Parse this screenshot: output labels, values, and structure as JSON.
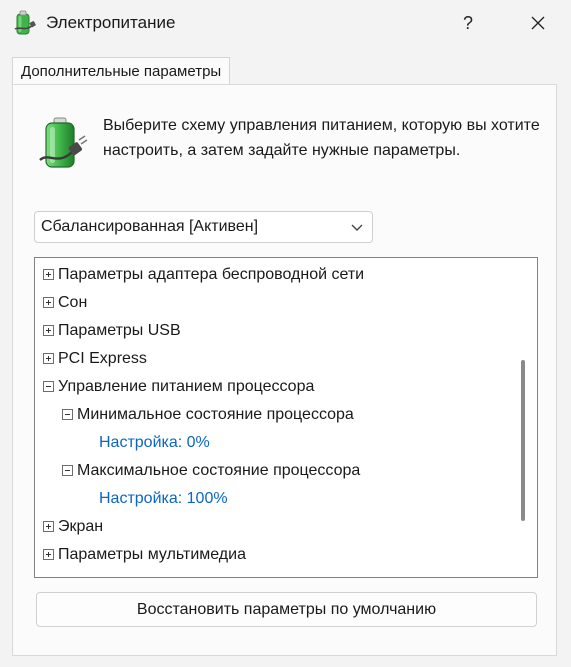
{
  "window": {
    "title": "Электропитание",
    "help_label": "?"
  },
  "tabs": [
    {
      "label": "Дополнительные параметры",
      "selected": true
    }
  ],
  "instructions": "Выберите схему управления питанием, которую вы хотите настроить, а затем задайте нужные параметры.",
  "scheme_select": {
    "value": "Сбалансированная [Активен]"
  },
  "tree": {
    "items": [
      {
        "label": "Параметры адаптера беспроводной сети",
        "expander": "plus",
        "level": 0
      },
      {
        "label": "Сон",
        "expander": "plus",
        "level": 0
      },
      {
        "label": "Параметры USB",
        "expander": "plus",
        "level": 0
      },
      {
        "label": "PCI Express",
        "expander": "plus",
        "level": 0
      },
      {
        "label": "Управление питанием процессора",
        "expander": "minus",
        "level": 0
      },
      {
        "label": "Минимальное состояние процессора",
        "expander": "minus",
        "level": 1
      },
      {
        "label": "Настройка: 0%",
        "expander": "none",
        "level": 2
      },
      {
        "label": "Максимальное состояние процессора",
        "expander": "minus",
        "level": 1
      },
      {
        "label": "Настройка: 100%",
        "expander": "none",
        "level": 2
      },
      {
        "label": "Экран",
        "expander": "plus",
        "level": 0
      },
      {
        "label": "Параметры мультимедиа",
        "expander": "plus",
        "level": 0
      }
    ]
  },
  "restore_button": {
    "label": "Восстановить параметры по умолчанию"
  },
  "colors": {
    "accent_link": "#0a66c2",
    "battery_green": "#3fb549"
  }
}
